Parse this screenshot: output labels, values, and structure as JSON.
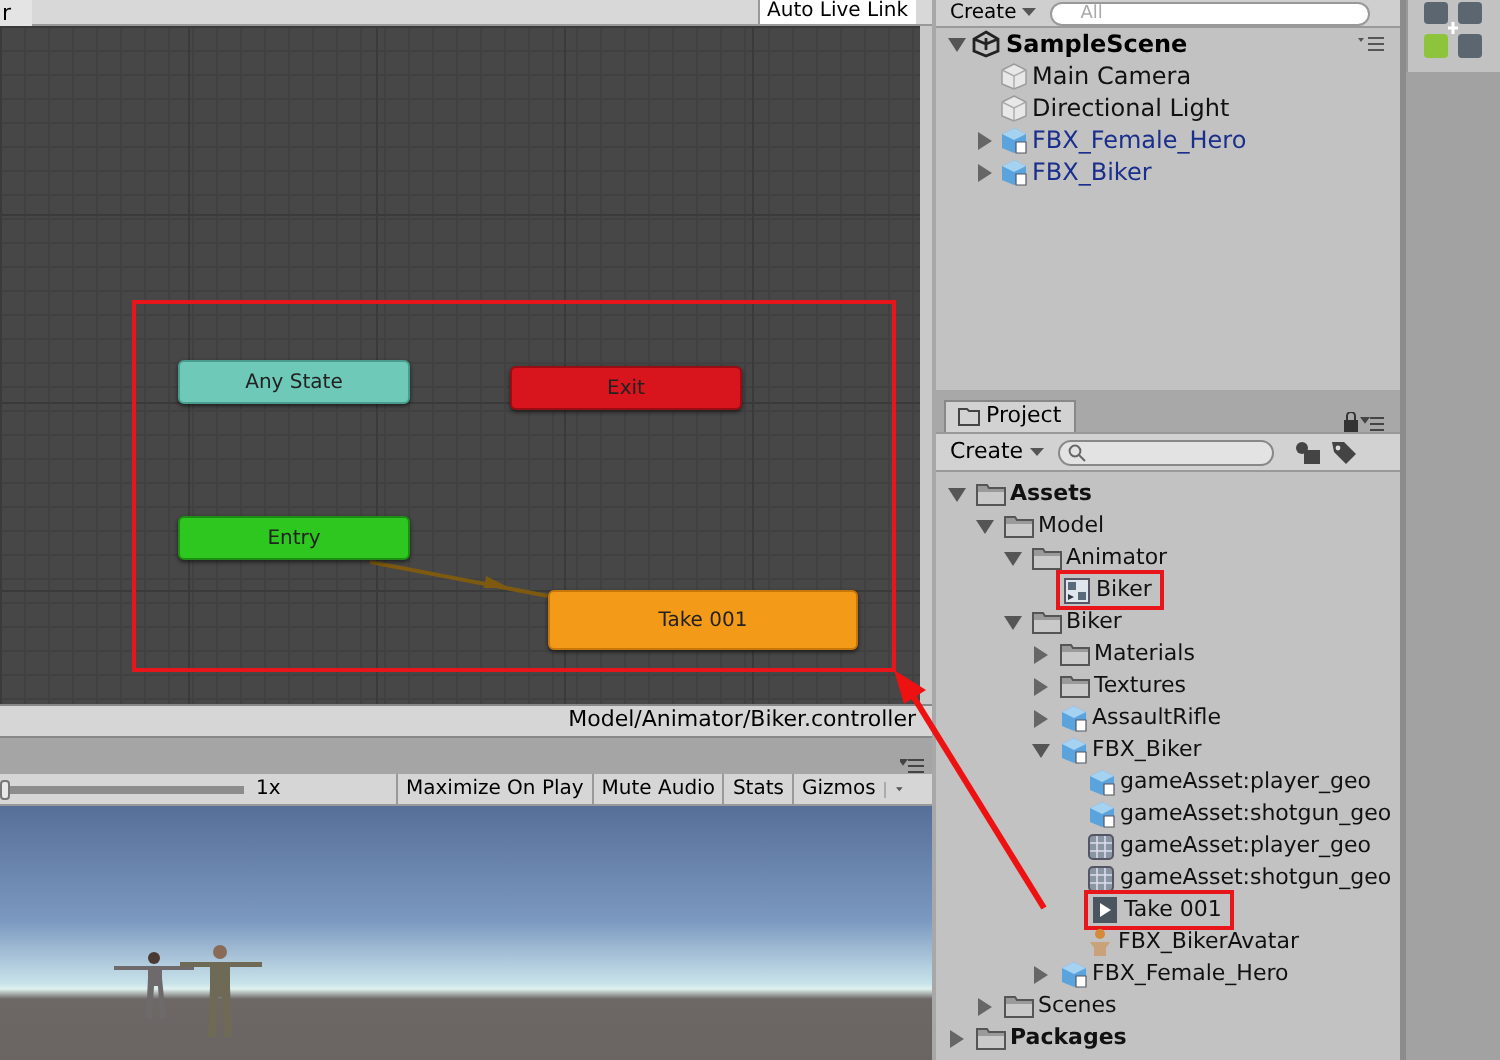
{
  "animator": {
    "breadcrumb": "r",
    "auto_live_link": "Auto Live Link",
    "states": [
      {
        "label": "Any State",
        "kind": "any"
      },
      {
        "label": "Exit",
        "kind": "exit"
      },
      {
        "label": "Entry",
        "kind": "entry"
      },
      {
        "label": "Take 001",
        "kind": "default"
      }
    ],
    "status": "Model/Animator/Biker.controller"
  },
  "game": {
    "scale_slider": {
      "level": 0
    },
    "scale": "1x",
    "buttons": [
      {
        "label": "Maximize On Play",
        "dropdown": false
      },
      {
        "label": "Mute Audio",
        "dropdown": false
      },
      {
        "label": "Stats",
        "dropdown": false
      },
      {
        "label": "Gizmos",
        "dropdown": true
      }
    ]
  },
  "hierarchy": {
    "create": "Create",
    "search_placeholder": "All",
    "scene": "SampleScene",
    "items": [
      {
        "label": "Main Camera",
        "kind": "object"
      },
      {
        "label": "Directional Light",
        "kind": "object"
      },
      {
        "label": "FBX_Female_Hero",
        "kind": "prefab",
        "expanded": false
      },
      {
        "label": "FBX_Biker",
        "kind": "prefab",
        "expanded": false
      }
    ]
  },
  "project": {
    "tab": "Project",
    "create": "Create",
    "tree": [
      {
        "label": "Assets",
        "kind": "root",
        "expanded": true,
        "highlighted": false,
        "children": [
          {
            "label": "Model",
            "kind": "folder",
            "expanded": true,
            "highlighted": false,
            "children": [
              {
                "label": "Animator",
                "kind": "folder",
                "expanded": true,
                "highlighted": false,
                "children": [
                  {
                    "label": "Biker",
                    "kind": "controller",
                    "highlighted": true
                  }
                ]
              },
              {
                "label": "Biker",
                "kind": "folder",
                "expanded": true,
                "highlighted": false,
                "children": [
                  {
                    "label": "Materials",
                    "kind": "folder",
                    "expanded": false,
                    "highlighted": false
                  },
                  {
                    "label": "Textures",
                    "kind": "folder",
                    "expanded": false,
                    "highlighted": false
                  },
                  {
                    "label": "AssaultRifle",
                    "kind": "model",
                    "expanded": false,
                    "highlighted": false
                  },
                  {
                    "label": "FBX_Biker",
                    "kind": "model",
                    "expanded": true,
                    "highlighted": false,
                    "children": [
                      {
                        "label": "gameAsset:player_geo",
                        "kind": "model",
                        "highlighted": false
                      },
                      {
                        "label": "gameAsset:shotgun_geo",
                        "kind": "model",
                        "highlighted": false
                      },
                      {
                        "label": "gameAsset:player_geo",
                        "kind": "mesh",
                        "highlighted": false
                      },
                      {
                        "label": "gameAsset:shotgun_geo",
                        "kind": "mesh",
                        "highlighted": false
                      },
                      {
                        "label": "Take 001",
                        "kind": "clip",
                        "highlighted": true
                      },
                      {
                        "label": "FBX_BikerAvatar",
                        "kind": "avatar",
                        "highlighted": false
                      }
                    ]
                  },
                  {
                    "label": "FBX_Female_Hero",
                    "kind": "model",
                    "expanded": false,
                    "highlighted": false
                  }
                ]
              }
            ]
          },
          {
            "label": "Scenes",
            "kind": "folder",
            "expanded": false,
            "highlighted": false
          }
        ]
      },
      {
        "label": "Packages",
        "kind": "root",
        "expanded": false,
        "highlighted": false
      }
    ]
  }
}
